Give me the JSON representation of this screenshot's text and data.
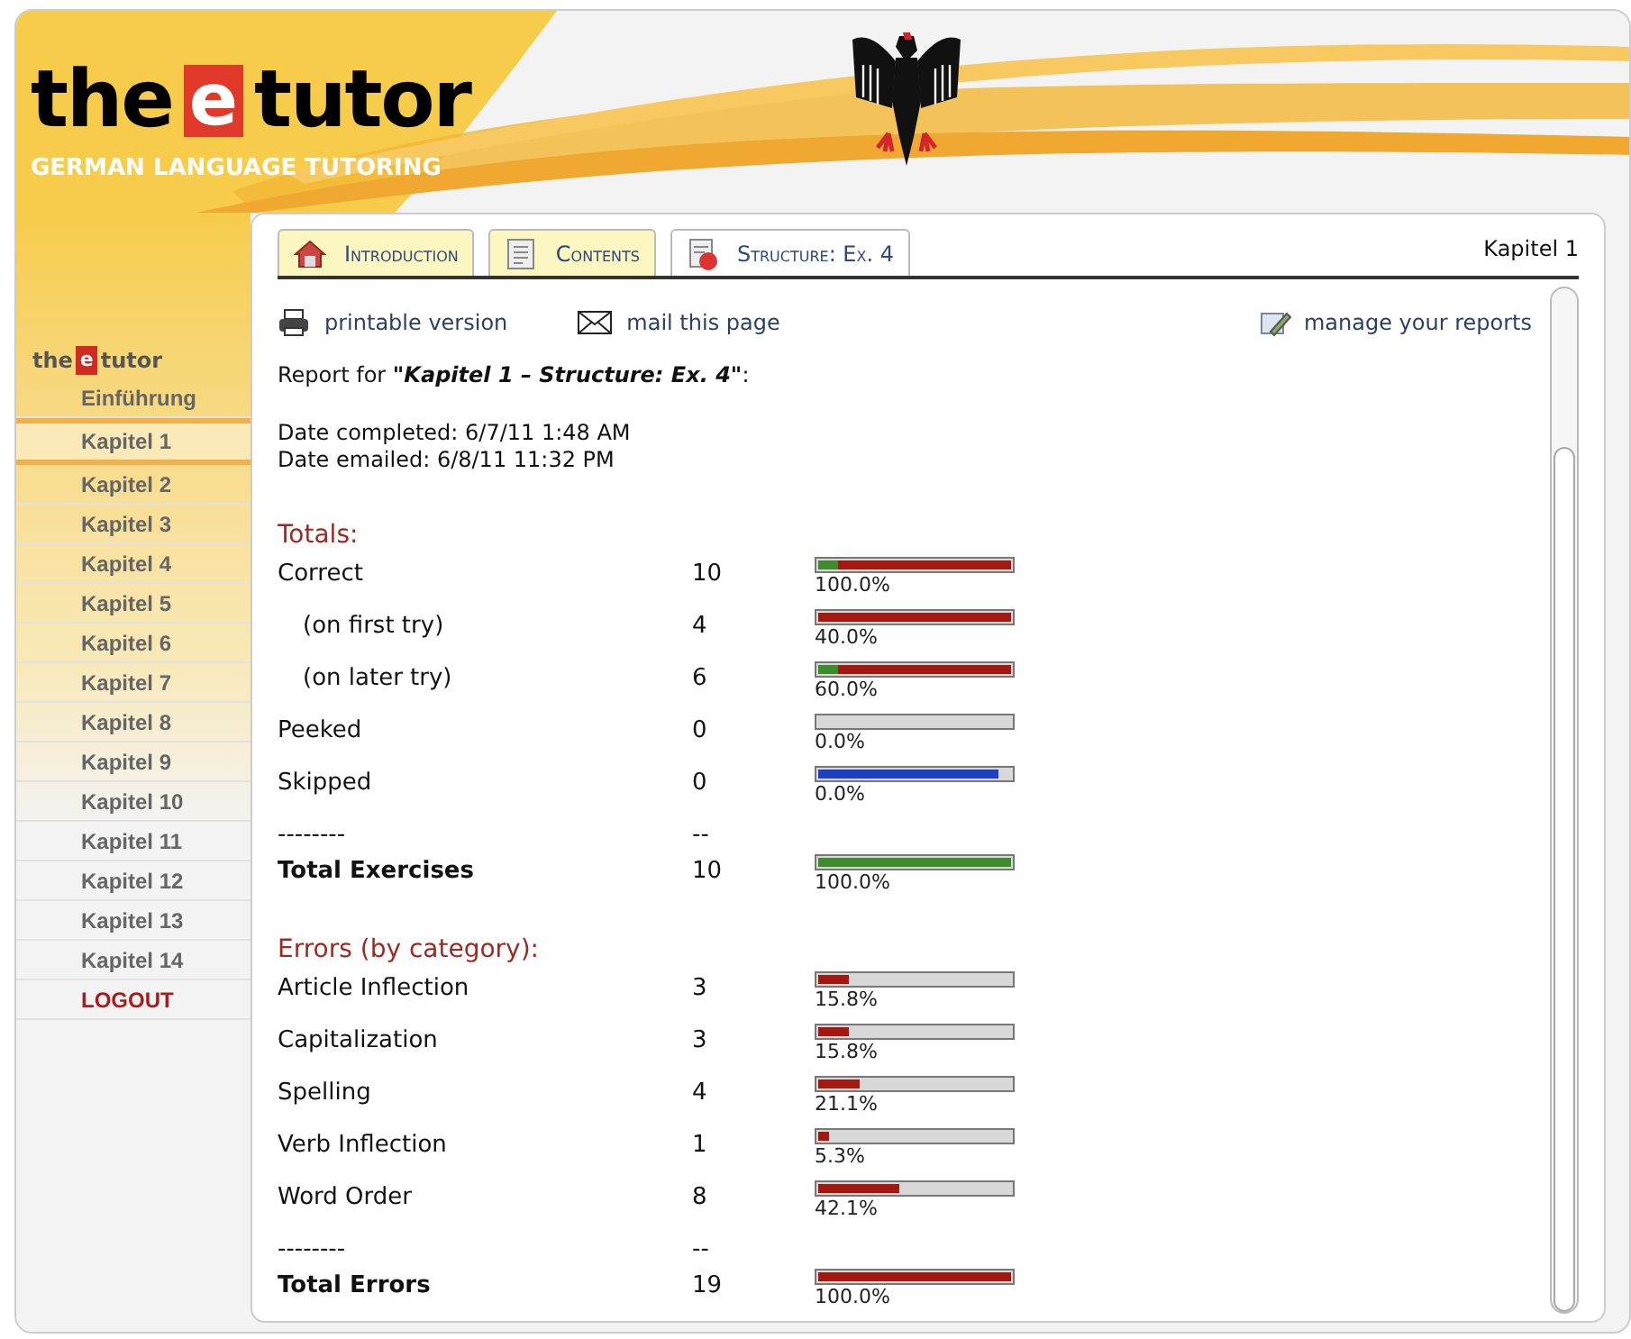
{
  "logo": {
    "word_1": "the",
    "letter": "e",
    "word_2": "tutor",
    "tagline": "GERMAN LANGUAGE TUTORING"
  },
  "sidebar": {
    "logo": {
      "word_1": "the",
      "letter": "e",
      "word_2": "tutor"
    },
    "items": [
      {
        "label": "Einführung",
        "selected": false,
        "kind": "link"
      },
      {
        "label": "Kapitel 1",
        "selected": true,
        "kind": "link"
      },
      {
        "label": "Kapitel 2",
        "selected": false,
        "kind": "link"
      },
      {
        "label": "Kapitel 3",
        "selected": false,
        "kind": "link"
      },
      {
        "label": "Kapitel 4",
        "selected": false,
        "kind": "link"
      },
      {
        "label": "Kapitel 5",
        "selected": false,
        "kind": "link"
      },
      {
        "label": "Kapitel 6",
        "selected": false,
        "kind": "link"
      },
      {
        "label": "Kapitel 7",
        "selected": false,
        "kind": "link"
      },
      {
        "label": "Kapitel 8",
        "selected": false,
        "kind": "link"
      },
      {
        "label": "Kapitel 9",
        "selected": false,
        "kind": "link"
      },
      {
        "label": "Kapitel 10",
        "selected": false,
        "kind": "link"
      },
      {
        "label": "Kapitel 11",
        "selected": false,
        "kind": "link"
      },
      {
        "label": "Kapitel 12",
        "selected": false,
        "kind": "link"
      },
      {
        "label": "Kapitel 13",
        "selected": false,
        "kind": "link"
      },
      {
        "label": "Kapitel 14",
        "selected": false,
        "kind": "link"
      },
      {
        "label": "LOGOUT",
        "selected": false,
        "kind": "logout"
      }
    ]
  },
  "tabs": [
    {
      "label": "Introduction",
      "selected": false,
      "kind": "home"
    },
    {
      "label": "Contents",
      "selected": false,
      "kind": "contents"
    },
    {
      "label": "Structure: Ex. 4",
      "selected": true,
      "kind": "structure"
    }
  ],
  "chapter": "Kapitel 1",
  "actions": [
    {
      "label": "printable version",
      "kind": "print"
    },
    {
      "label": "mail this page",
      "kind": "mail"
    }
  ],
  "manage_link": "manage your reports",
  "report_title": "Report for **\"Kapitel 1 – Structure: Ex. 4\"**:",
  "date_completed": "Date completed: 6/7/11 1:48 AM",
  "date_emailed": "Date emailed: 6/8/11 11:32 PM",
  "sections": [
    {
      "heading": "Totals:",
      "rows": [
        {
          "label": "Correct",
          "count": "10",
          "percent": "100.0%",
          "kind": "plain",
          "bar": [
            {
              "color": "#3c8c2c",
              "level": 0.1
            },
            {
              "color": "#a3180f",
              "level": 0.9
            }
          ]
        },
        {
          "label": "(on first try)",
          "count": "4",
          "percent": "40.0%",
          "kind": "sub",
          "bar": [
            {
              "color": "#a3180f",
              "level": 1
            }
          ]
        },
        {
          "label": "(on later try)",
          "count": "6",
          "percent": "60.0%",
          "kind": "sub",
          "bar": [
            {
              "color": "#3c8c2c",
              "level": 0.1
            },
            {
              "color": "#a3180f",
              "level": 0.9
            }
          ]
        },
        {
          "label": "Peeked",
          "count": "0",
          "percent": "0.0%",
          "kind": "plain",
          "bar": []
        },
        {
          "label": "Skipped",
          "count": "0",
          "percent": "0.0%",
          "kind": "plain",
          "bar": [
            {
              "color": "#1c3fc4",
              "level": 0.93
            }
          ]
        },
        {
          "label": "--------",
          "count": "--",
          "kind": "divider"
        },
        {
          "label": "Total Exercises",
          "count": "10",
          "percent": "100.0%",
          "kind": "total",
          "bar": [
            {
              "color": "#3c8c2c",
              "level": 1
            }
          ]
        }
      ]
    },
    {
      "heading": "Errors (by category):",
      "rows": [
        {
          "label": "Article Inflection",
          "count": "3",
          "percent": "15.8%",
          "kind": "plain",
          "bar": [
            {
              "color": "#a3180f",
              "level": 0.158
            }
          ]
        },
        {
          "label": "Capitalization",
          "count": "3",
          "percent": "15.8%",
          "kind": "plain",
          "bar": [
            {
              "color": "#a3180f",
              "level": 0.158
            }
          ]
        },
        {
          "label": "Spelling",
          "count": "4",
          "percent": "21.1%",
          "kind": "plain",
          "bar": [
            {
              "color": "#a3180f",
              "level": 0.211
            }
          ]
        },
        {
          "label": "Verb Inflection",
          "count": "1",
          "percent": "5.3%",
          "kind": "plain",
          "bar": [
            {
              "color": "#a3180f",
              "level": 0.053
            }
          ]
        },
        {
          "label": "Word Order",
          "count": "8",
          "percent": "42.1%",
          "kind": "plain",
          "bar": [
            {
              "color": "#a3180f",
              "level": 0.421
            }
          ]
        },
        {
          "label": "--------",
          "count": "--",
          "kind": "divider"
        },
        {
          "label": "Total Errors",
          "count": "19",
          "percent": "100.0%",
          "kind": "total",
          "bar": [
            {
              "color": "#a3180f",
              "level": 1
            }
          ]
        }
      ]
    }
  ]
}
